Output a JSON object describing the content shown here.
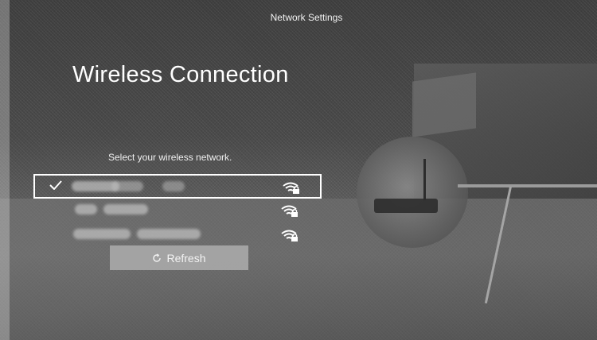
{
  "header": {
    "title": "Network Settings"
  },
  "page_title": "Wireless Connection",
  "instruction": "Select your wireless network.",
  "networks": [
    {
      "selected": true,
      "secured": true,
      "icon": "wifi-lock-icon"
    },
    {
      "selected": false,
      "secured": true,
      "icon": "wifi-lock-icon"
    },
    {
      "selected": false,
      "secured": true,
      "icon": "wifi-lock-icon"
    }
  ],
  "refresh_button": {
    "label": "Refresh",
    "icon": "refresh-icon"
  },
  "colors": {
    "text": "#ffffff",
    "button_bg": "#a8a8a8",
    "selection_border": "#ffffff"
  }
}
